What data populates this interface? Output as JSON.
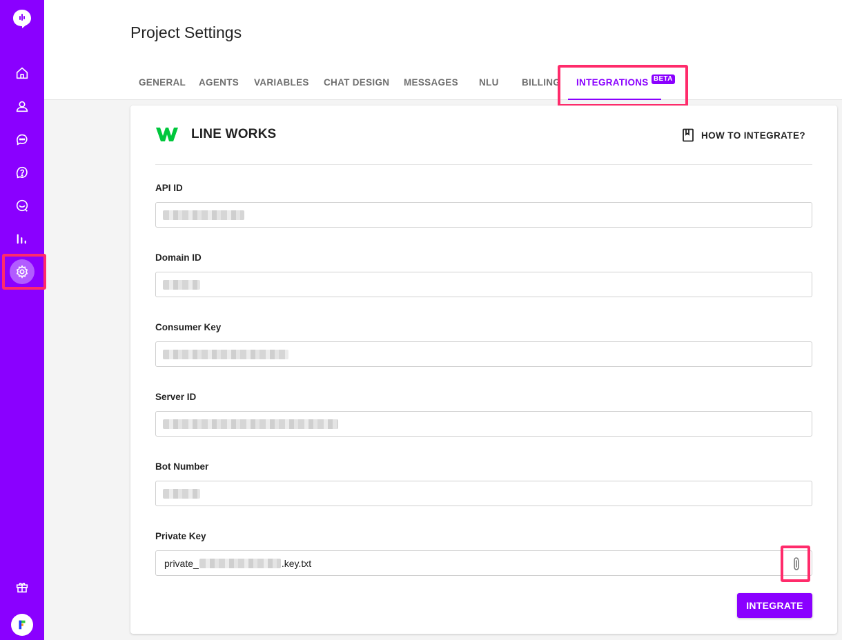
{
  "sidebar": {
    "icons": [
      "logo-chat-icon",
      "home-icon",
      "user-icon",
      "chat-icon",
      "help-icon",
      "conversations-icon",
      "analytics-icon",
      "settings-icon",
      "gift-icon",
      "avatar-icon"
    ],
    "accent": "#8a00ff"
  },
  "header": {
    "title": "Project Settings",
    "tabs": [
      {
        "label": "GENERAL"
      },
      {
        "label": "AGENTS"
      },
      {
        "label": "VARIABLES"
      },
      {
        "label": "CHAT DESIGN"
      },
      {
        "label": "MESSAGES"
      },
      {
        "label": "NLU"
      },
      {
        "label": "BILLING"
      },
      {
        "label": "INTEGRATIONS",
        "badge": "BETA",
        "active": true
      }
    ]
  },
  "integration": {
    "name": "LINE WORKS",
    "brand_color": "#00c73c",
    "how_to": "HOW TO INTEGRATE?",
    "fields": [
      {
        "label": "API ID",
        "value": ""
      },
      {
        "label": "Domain ID",
        "value": ""
      },
      {
        "label": "Consumer Key",
        "value": ""
      },
      {
        "label": "Server ID",
        "value": ""
      },
      {
        "label": "Bot Number",
        "value": ""
      },
      {
        "label": "Private Key",
        "prefix": "private_",
        "suffix": ".key.txt"
      }
    ],
    "submit_label": "INTEGRATE"
  },
  "annotation_color": "#ff2b6b"
}
